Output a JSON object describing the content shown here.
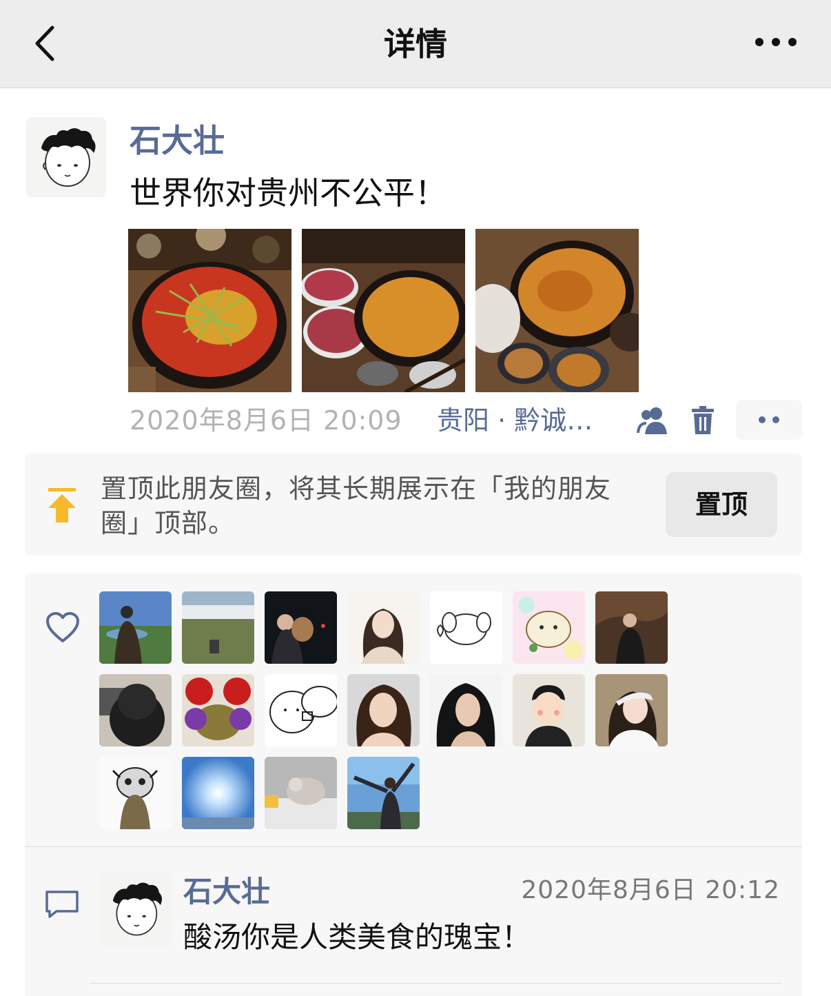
{
  "nav": {
    "title": "详情",
    "back_icon": "chevron-left-icon",
    "more_icon": "ellipsis-icon"
  },
  "post": {
    "author": "石大壮",
    "text": "世界你对贵州不公平！",
    "photo_count": 3,
    "time": "2020年8月6日 20:09",
    "location": "贵阳 · 黔诚…",
    "icons": [
      "people-icon",
      "trash-icon",
      "more-dots-icon"
    ]
  },
  "pin": {
    "text": "置顶此朋友圈，将其长期展示在「我的朋友圈」顶部。",
    "button_label": "置顶",
    "icon": "pin-top-icon"
  },
  "likes": {
    "icon": "heart-icon",
    "count": 18
  },
  "comments": [
    {
      "author": "石大壮",
      "time": "2020年8月6日 20:12",
      "text": "酸汤你是人类美食的瑰宝！"
    }
  ],
  "colors": {
    "link_blue": "#576b95",
    "navbar_bg": "#ededed",
    "card_bg": "#f7f7f7",
    "pin_yellow": "#f5b92a"
  }
}
